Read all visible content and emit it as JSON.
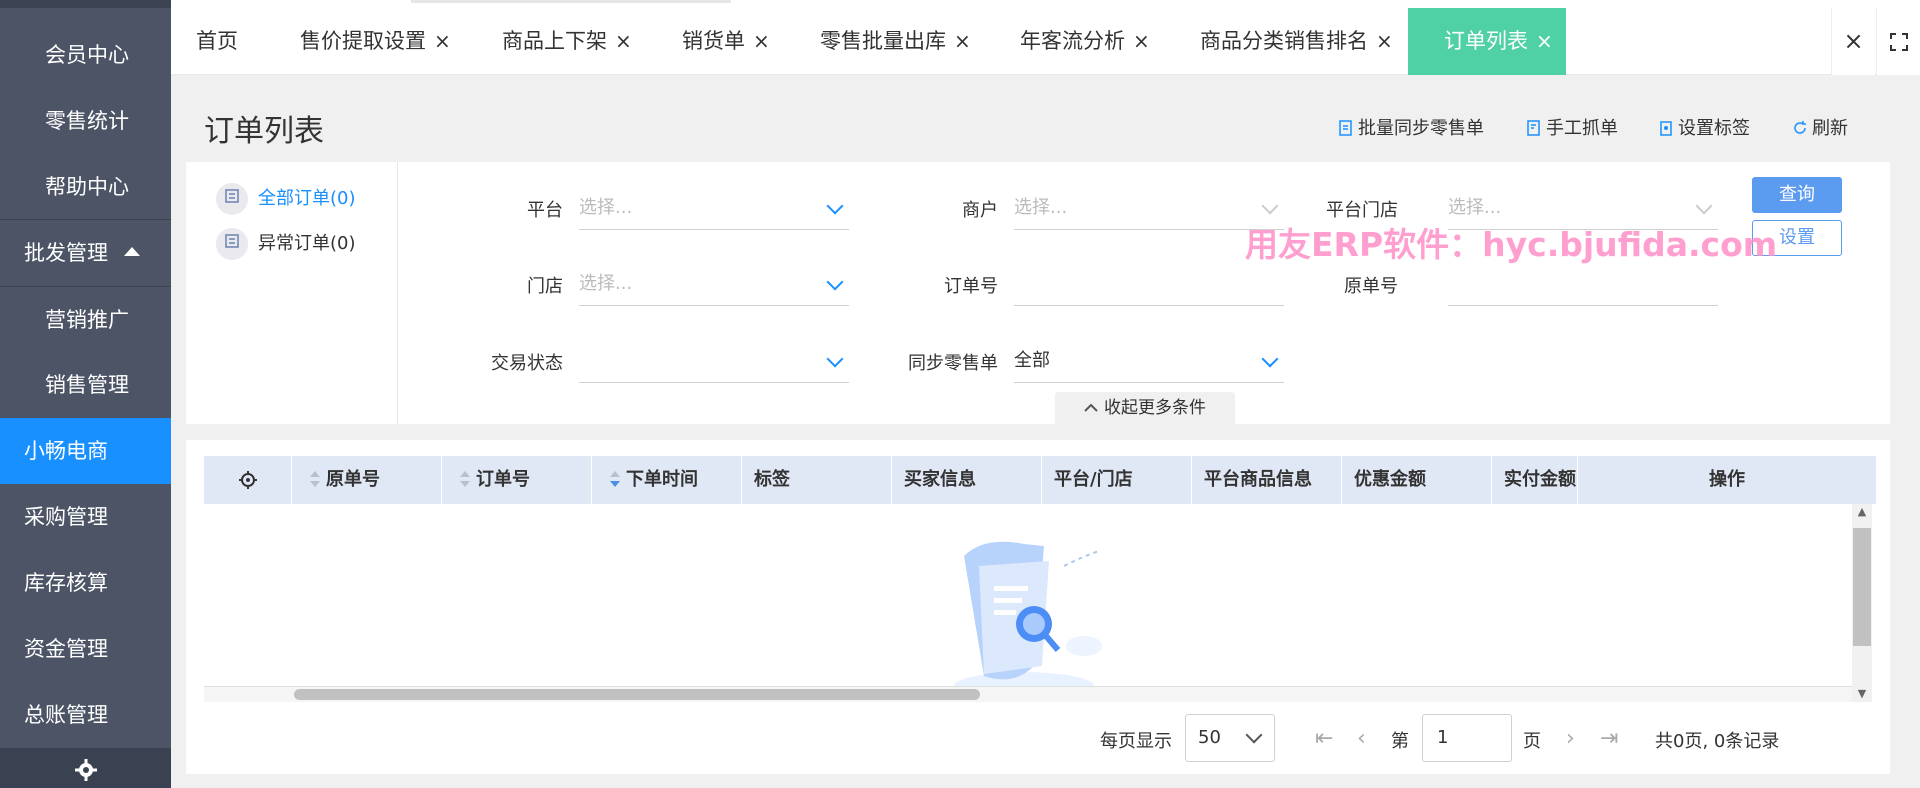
{
  "sidebar": {
    "items": [
      {
        "label": "会员中心"
      },
      {
        "label": "零售统计"
      },
      {
        "label": "帮助中心"
      },
      {
        "label": "批发管理"
      },
      {
        "label": "营销推广"
      },
      {
        "label": "销售管理"
      },
      {
        "label": "小畅电商"
      },
      {
        "label": "采购管理"
      },
      {
        "label": "库存核算"
      },
      {
        "label": "资金管理"
      },
      {
        "label": "总账管理"
      }
    ],
    "active": "小畅电商"
  },
  "tabs": [
    {
      "label": "首页"
    },
    {
      "label": "售价提取设置"
    },
    {
      "label": "商品上下架"
    },
    {
      "label": "销货单"
    },
    {
      "label": "零售批量出库"
    },
    {
      "label": "年客流分析"
    },
    {
      "label": "商品分类销售排名"
    },
    {
      "label": "订单列表"
    }
  ],
  "tab_close_glyph": "×",
  "header": {
    "title": "订单列表",
    "actions": [
      {
        "label": "批量同步零售单"
      },
      {
        "label": "手工抓单"
      },
      {
        "label": "设置标签"
      },
      {
        "label": "刷新"
      }
    ]
  },
  "side_filters": [
    {
      "label": "全部订单(0)"
    },
    {
      "label": "异常订单(0)"
    }
  ],
  "filters": {
    "platform": {
      "label": "平台",
      "placeholder": "选择..."
    },
    "merchant": {
      "label": "商户",
      "placeholder": "选择..."
    },
    "platform_store": {
      "label": "平台门店",
      "placeholder": "选择..."
    },
    "store": {
      "label": "门店",
      "placeholder": "选择..."
    },
    "order_no": {
      "label": "订单号",
      "value": ""
    },
    "original_no": {
      "label": "原单号",
      "value": ""
    },
    "trade_status": {
      "label": "交易状态",
      "value": ""
    },
    "sync_retail": {
      "label": "同步零售单",
      "value": "全部"
    }
  },
  "buttons": {
    "query": "查询",
    "settings": "设置",
    "collapse": "收起更多条件"
  },
  "watermark": "用友ERP软件：hyc.bjufida.com",
  "table": {
    "columns": [
      "原单号",
      "订单号",
      "下单时间",
      "标签",
      "买家信息",
      "平台/门店",
      "平台商品信息",
      "优惠金额",
      "实付金额",
      "操作"
    ]
  },
  "pagination": {
    "per_page_label": "每页显示",
    "per_page": "50",
    "page_prefix": "第",
    "page": "1",
    "page_suffix": "页",
    "summary": "共0页, 0条记录"
  },
  "colors": {
    "accent": "#1890ff",
    "active_tab": "#4fd1a5",
    "sidebar": "#4c5466"
  }
}
